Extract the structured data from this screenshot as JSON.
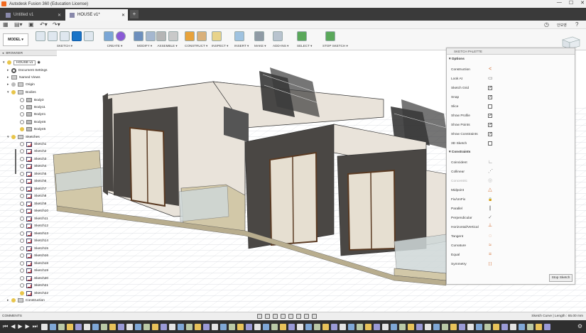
{
  "window": {
    "title": "Autodesk Fusion 360 (Education License)",
    "controls": [
      "—",
      "☐",
      "✕"
    ]
  },
  "tabs": [
    {
      "label": "Untitled v1",
      "active": false
    },
    {
      "label": "HOUSE v1*",
      "active": true
    }
  ],
  "quick_access": {
    "user": "안보영",
    "help": "?"
  },
  "toolbar": {
    "workspace": "MODEL ▾",
    "groups": [
      {
        "label": "SKETCH ▾"
      },
      {
        "label": "CREATE ▾"
      },
      {
        "label": "MODIFY ▾"
      },
      {
        "label": "ASSEMBLE ▾"
      },
      {
        "label": "CONSTRUCT ▾"
      },
      {
        "label": "INSPECT ▾"
      },
      {
        "label": "INSERT ▾"
      },
      {
        "label": "MAKE ▾"
      },
      {
        "label": "ADD-INS ▾"
      },
      {
        "label": "SELECT ▾"
      },
      {
        "label": "STOP SKETCH ▾"
      }
    ]
  },
  "browser": {
    "header": "BROWSER",
    "root": "HOUSE v1",
    "items": [
      {
        "label": "Document Settings"
      },
      {
        "label": "Named Views"
      },
      {
        "label": "Origin"
      },
      {
        "label": "Bodies"
      },
      {
        "label": "Body3"
      },
      {
        "label": "Body11"
      },
      {
        "label": "Body41"
      },
      {
        "label": "Body46"
      },
      {
        "label": "Body45"
      },
      {
        "label": "Sketches"
      },
      {
        "label": "Sketch1"
      },
      {
        "label": "Sketch2"
      },
      {
        "label": "Sketch3"
      },
      {
        "label": "Sketch4"
      },
      {
        "label": "Sketch5"
      },
      {
        "label": "Sketch6"
      },
      {
        "label": "Sketch7"
      },
      {
        "label": "Sketch8"
      },
      {
        "label": "Sketch9"
      },
      {
        "label": "Sketch10"
      },
      {
        "label": "Sketch11"
      },
      {
        "label": "Sketch12"
      },
      {
        "label": "Sketch13"
      },
      {
        "label": "Sketch14"
      },
      {
        "label": "Sketch15"
      },
      {
        "label": "Sketch16"
      },
      {
        "label": "Sketch18"
      },
      {
        "label": "Sketch19"
      },
      {
        "label": "Sketch20"
      },
      {
        "label": "Sketch21"
      },
      {
        "label": "Sketch22"
      },
      {
        "label": "Construction"
      }
    ]
  },
  "palette": {
    "title": "SKETCH PALETTE",
    "options_header": "▾ Options",
    "options": [
      {
        "label": "Construction",
        "icon": "construction-icon"
      },
      {
        "label": "Look At",
        "icon": "look-at-icon"
      },
      {
        "label": "Sketch Grid",
        "checked": true
      },
      {
        "label": "Snap",
        "checked": true
      },
      {
        "label": "Slice",
        "checked": false
      },
      {
        "label": "Show Profile",
        "checked": true
      },
      {
        "label": "Show Points",
        "checked": true
      },
      {
        "label": "Show Constraints",
        "checked": true
      },
      {
        "label": "3D Sketch",
        "checked": false
      }
    ],
    "constraints_header": "▾ Constraints",
    "constraints": [
      {
        "label": "Coincident",
        "glyph": "∟"
      },
      {
        "label": "Collinear",
        "glyph": "⋰"
      },
      {
        "label": "Concentric",
        "glyph": "◎"
      },
      {
        "label": "Midpoint",
        "glyph": "△"
      },
      {
        "label": "Fix/UnFix",
        "glyph": "🔒"
      },
      {
        "label": "Parallel",
        "glyph": "∥"
      },
      {
        "label": "Perpendicular",
        "glyph": "✓"
      },
      {
        "label": "Horizontal/Vertical",
        "glyph": "┴"
      },
      {
        "label": "Tangent",
        "glyph": "◌"
      },
      {
        "label": "Curvature",
        "glyph": "≈"
      },
      {
        "label": "Equal",
        "glyph": "="
      },
      {
        "label": "Symmetry",
        "glyph": "[ ]"
      }
    ],
    "stop_button": "Stop Sketch"
  },
  "statusbar": {
    "comments": "COMMENTS",
    "sketch_info": "Sketch Curve | Length : 65.00 mm"
  },
  "colors": {
    "accent": "#1a74c8",
    "wall_dark": "#4a4744",
    "wall_light": "#e9e3da",
    "floor": "#c9bf9a",
    "glass": "#cfd8d8"
  }
}
